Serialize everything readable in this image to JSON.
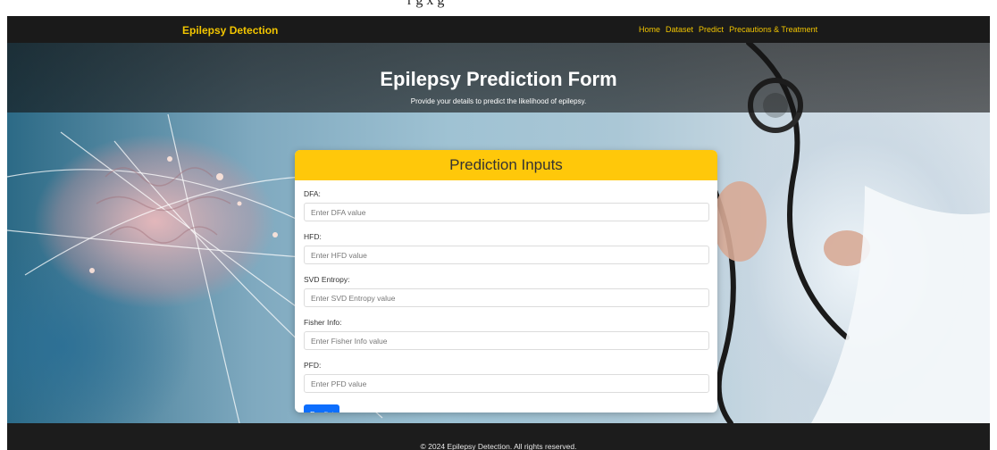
{
  "top_caption": "r         g        x      g",
  "navbar": {
    "brand": "Epilepsy Detection",
    "links": [
      "Home",
      "Dataset",
      "Predict",
      "Precautions & Treatment"
    ]
  },
  "hero": {
    "title": "Epilepsy Prediction Form",
    "subtitle": "Provide your details to predict the likelihood of epilepsy."
  },
  "form": {
    "header": "Prediction Inputs",
    "fields": [
      {
        "label": "DFA:",
        "placeholder": "Enter DFA value"
      },
      {
        "label": "HFD:",
        "placeholder": "Enter HFD value"
      },
      {
        "label": "SVD Entropy:",
        "placeholder": "Enter SVD Entropy value"
      },
      {
        "label": "Fisher Info:",
        "placeholder": "Enter Fisher Info value"
      },
      {
        "label": "PFD:",
        "placeholder": "Enter PFD value"
      }
    ],
    "submit_label": "Predict"
  },
  "footer": {
    "text": "© 2024 Epilepsy Detection. All rights reserved."
  },
  "colors": {
    "accent": "#f2c500",
    "card_header": "#ffc80a",
    "button": "#0d6efd",
    "navbar": "#1a1a1a"
  }
}
